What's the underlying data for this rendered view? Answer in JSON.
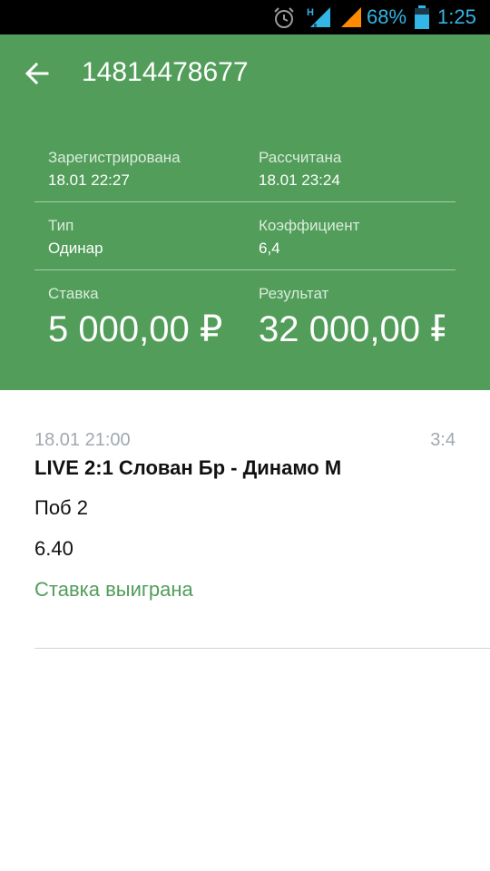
{
  "status_bar": {
    "network_type": "H",
    "battery_percent": "68%",
    "time": "1:25",
    "icons": [
      "alarm-icon",
      "signal-icon",
      "signal-icon",
      "battery-icon"
    ],
    "accent_color": "#33b5e5"
  },
  "header": {
    "bet_id": "14814478677",
    "background_color": "#529d5a",
    "registered": {
      "label": "Зарегистрирована",
      "value": "18.01 22:27"
    },
    "settled": {
      "label": "Рассчитана",
      "value": "18.01 23:24"
    },
    "type": {
      "label": "Тип",
      "value": "Одинар"
    },
    "coefficient": {
      "label": "Коэффициент",
      "value": "6,4"
    },
    "stake": {
      "label": "Ставка",
      "value": "5 000,00 ₽"
    },
    "result": {
      "label": "Результат",
      "value": "32 000,00 ₽"
    }
  },
  "event": {
    "date": "18.01 21:00",
    "score": "3:4",
    "title": "LIVE 2:1 Слован Бр - Динамо М",
    "outcome": "Поб 2",
    "odds": "6.40",
    "status": "Ставка выиграна",
    "status_color": "#529d5a"
  }
}
